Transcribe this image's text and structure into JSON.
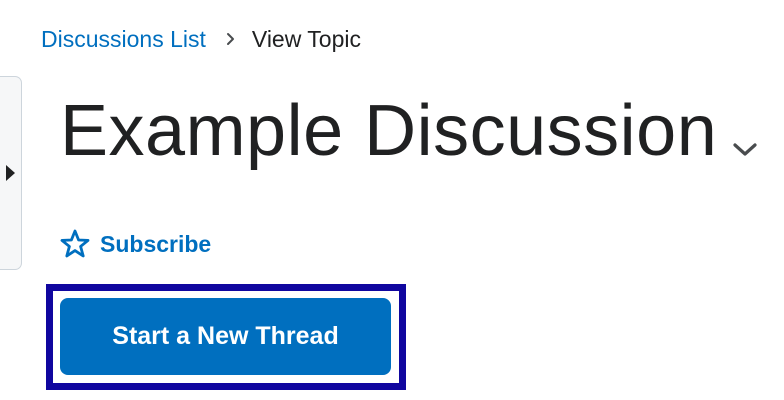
{
  "breadcrumb": {
    "parent_label": "Discussions List",
    "separator_icon": "chevron-right-icon",
    "current_label": "View Topic"
  },
  "topic": {
    "title": "Example Discussion",
    "dropdown_icon": "chevron-down-icon"
  },
  "actions": {
    "subscribe_label": "Subscribe",
    "subscribe_icon": "star-outline-icon",
    "new_thread_label": "Start a New Thread"
  },
  "side_panel": {
    "toggle_icon": "caret-right-icon"
  },
  "colors": {
    "link": "#006fbf",
    "primary_button": "#006fbf",
    "focus_outline": "#10069f",
    "text": "#202122"
  }
}
